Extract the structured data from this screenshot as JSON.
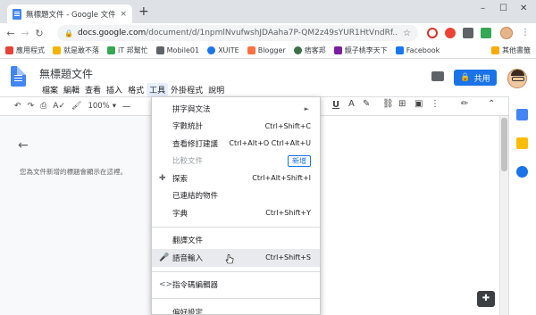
{
  "browser": {
    "tab_title": "無標題文件 - Google 文件",
    "tab_close": "×",
    "new_tab": "+",
    "window_controls": [
      "–",
      "☐",
      "✕"
    ],
    "url_host": "docs.google.com",
    "url_path": "/document/d/1npmlNvufwshJDAaha7P-QM2z49sYUR1HtVndRf..."
  },
  "bookmarks": [
    {
      "label": "應用程式",
      "color": "#e94235"
    },
    {
      "label": "就是敢不落",
      "color": "#f4b400"
    },
    {
      "label": "iT 邦幫忙",
      "color": "#34a853"
    },
    {
      "label": "Mobile01",
      "color": "#5f6368"
    },
    {
      "label": "XUITE",
      "color": "#1a73e8"
    },
    {
      "label": "Blogger",
      "color": "#ff7043"
    },
    {
      "label": "痞客邦",
      "color": "#3c6e48"
    },
    {
      "label": "鏡子桃李天下",
      "color": "#7b1fa2"
    },
    {
      "label": "Facebook",
      "color": "#1877f2"
    }
  ],
  "bookmarks_more": "其他書籤",
  "docs": {
    "title": "無標題文件",
    "menus": [
      "檔案",
      "編輯",
      "查看",
      "插入",
      "格式",
      "工具",
      "外掛程式",
      "說明"
    ],
    "share_label": "共用",
    "zoom": "100%",
    "outline_hint": "您為文件新增的標題會顯示在這裡。"
  },
  "tools_menu": [
    {
      "label": "拼字與文法",
      "shortcut": "",
      "arrow": "►",
      "disabled": false,
      "icon": ""
    },
    {
      "label": "字數統計",
      "shortcut": "Ctrl+Shift+C",
      "disabled": false,
      "icon": ""
    },
    {
      "label": "查看修訂建議",
      "shortcut": "Ctrl+Alt+O Ctrl+Alt+U",
      "disabled": false,
      "icon": ""
    },
    {
      "label": "比較文件",
      "badge": "新增",
      "disabled": true,
      "icon": ""
    },
    {
      "label": "探索",
      "shortcut": "Ctrl+Alt+Shift+I",
      "disabled": false,
      "icon": "✚"
    },
    {
      "label": "已連結的物件",
      "shortcut": "",
      "disabled": false,
      "icon": ""
    },
    {
      "label": "字典",
      "shortcut": "Ctrl+Shift+Y",
      "disabled": false,
      "icon": ""
    },
    {
      "label": "翻譯文件",
      "shortcut": "",
      "disabled": false,
      "icon": ""
    },
    {
      "label": "語音輸入",
      "shortcut": "Ctrl+Shift+S",
      "disabled": false,
      "icon": "🎤",
      "hover": true
    },
    {
      "label": "指令碼編輯器",
      "shortcut": "",
      "disabled": false,
      "icon": "<>"
    },
    {
      "label": "偏好設定",
      "shortcut": "",
      "disabled": false,
      "icon": ""
    }
  ]
}
